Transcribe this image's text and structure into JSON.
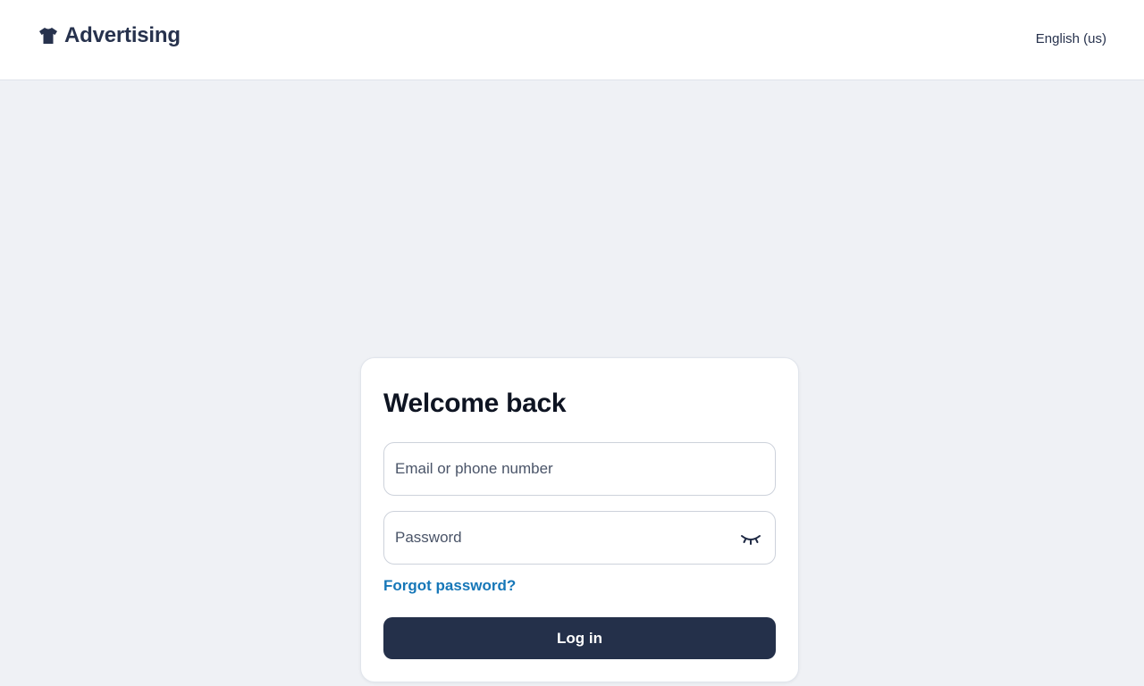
{
  "header": {
    "brand_icon": "shirt-icon",
    "brand_name": "Advertising",
    "language": "English (us)"
  },
  "login": {
    "title": "Welcome back",
    "email_placeholder": "Email or phone number",
    "email_value": "",
    "password_placeholder": "Password",
    "password_value": "",
    "password_toggle_icon": "eye-closed-icon",
    "forgot_label": "Forgot password?",
    "submit_label": "Log in"
  },
  "colors": {
    "page_bg": "#eff1f5",
    "header_bg": "#ffffff",
    "brand_text": "#27324d",
    "link": "#1677b8",
    "button_bg": "#24304a",
    "button_text": "#ffffff"
  }
}
